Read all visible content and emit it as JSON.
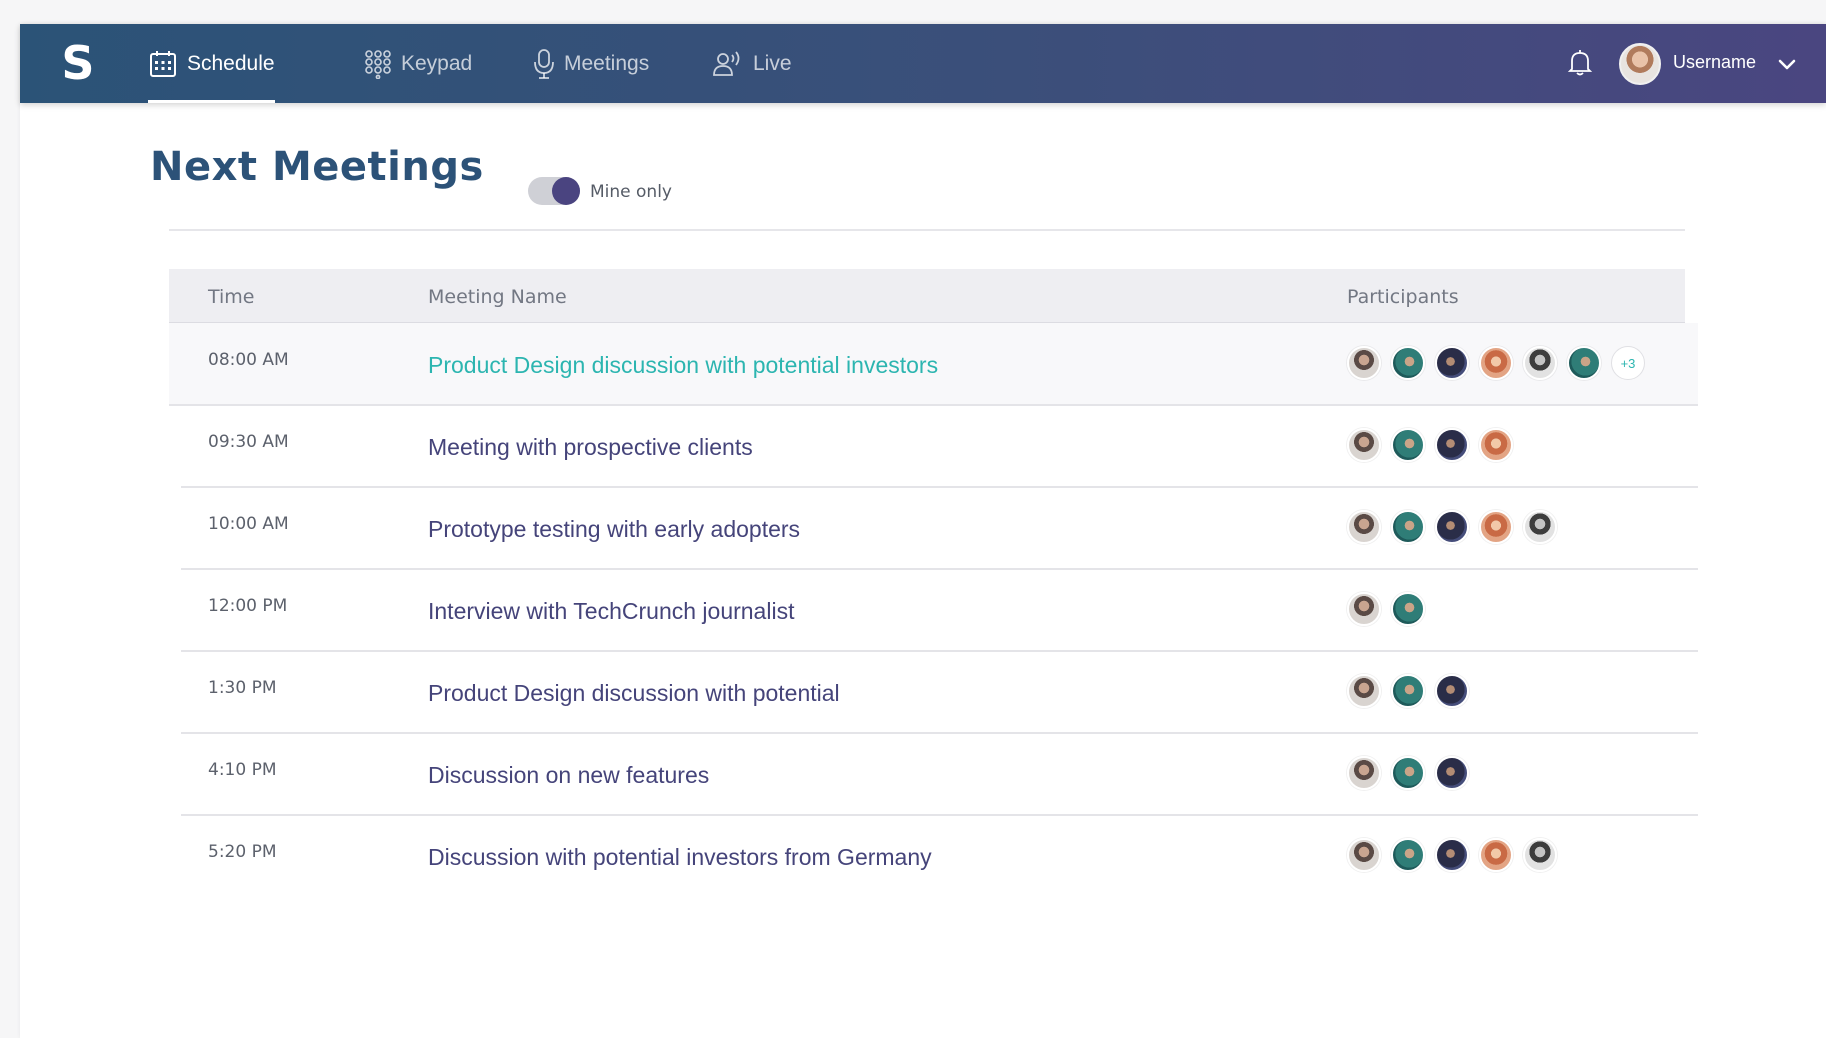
{
  "app": {
    "logo": "S"
  },
  "nav": {
    "items": [
      {
        "label": "Schedule",
        "icon": "calendar-icon",
        "active": true
      },
      {
        "label": "Keypad",
        "icon": "keypad-icon",
        "active": false
      },
      {
        "label": "Meetings",
        "icon": "microphone-icon",
        "active": false
      },
      {
        "label": "Live",
        "icon": "live-broadcast-icon",
        "active": false
      }
    ],
    "username": "Username"
  },
  "page": {
    "title": "Next Meetings",
    "toggle_label": "Mine only",
    "toggle_on": true
  },
  "table": {
    "headers": {
      "time": "Time",
      "name": "Meeting Name",
      "participants": "Participants"
    },
    "rows": [
      {
        "time": "08:00 AM",
        "name": "Product Design discussion with potential investors",
        "participants": 6,
        "more": "+3"
      },
      {
        "time": "09:30 AM",
        "name": "Meeting with prospective clients",
        "participants": 4
      },
      {
        "time": "10:00 AM",
        "name": "Prototype testing with early adopters",
        "participants": 5
      },
      {
        "time": "12:00 PM",
        "name": "Interview with TechCrunch journalist",
        "participants": 2
      },
      {
        "time": "1:30 PM",
        "name": "Product Design discussion with potential",
        "participants": 3
      },
      {
        "time": "4:10 PM",
        "name": "Discussion on new features",
        "participants": 3
      },
      {
        "time": "5:20 PM",
        "name": "Discussion with potential investors from Germany",
        "participants": 5
      }
    ]
  },
  "colors": {
    "nav_start": "#2b5377",
    "nav_end": "#4a4680",
    "title": "#2c5278",
    "link_highlight": "#2cb5b0",
    "row_text": "#45447a",
    "toggle_knob": "#4a4480"
  }
}
